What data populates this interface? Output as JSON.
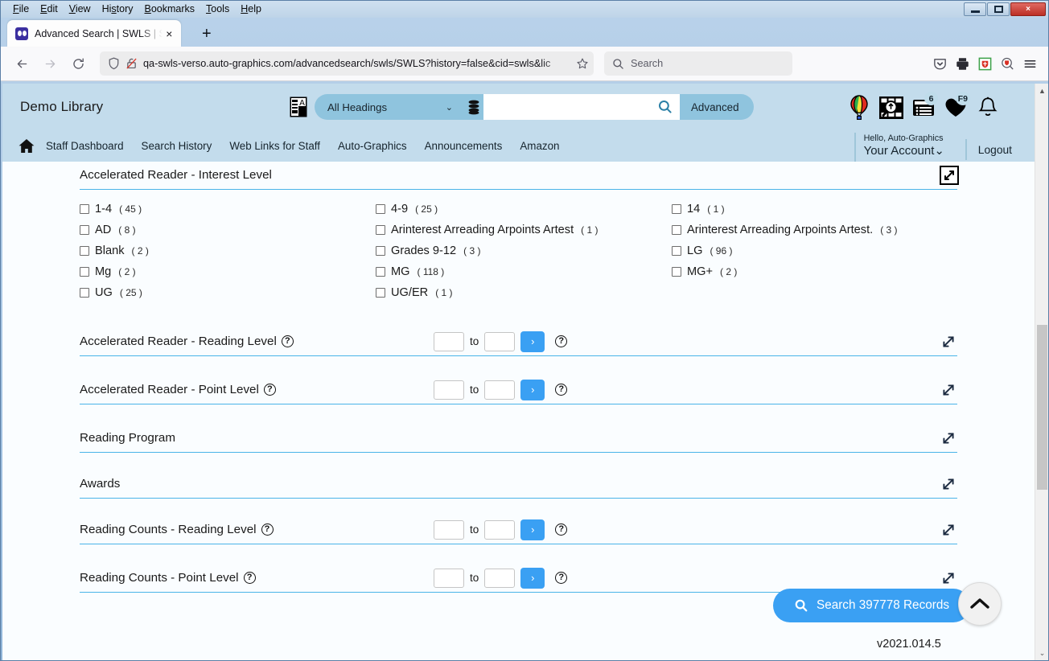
{
  "browser": {
    "menus": [
      "File",
      "Edit",
      "View",
      "History",
      "Bookmarks",
      "Tools",
      "Help"
    ],
    "window_controls": {
      "minimize": "minimize-icon",
      "maximize": "maximize-icon",
      "close": "×"
    },
    "tab": {
      "title": "Advanced Search | SWLS | SWLS",
      "close": "×",
      "favicon": "book-favicon"
    },
    "new_tab": "+",
    "nav": {
      "back": "back-arrow-icon",
      "forward": "forward-arrow-icon",
      "reload": "reload-icon",
      "shield": "shield-icon",
      "lock_broken": "broken-lock-icon",
      "url": "qa-swls-verso.auto-graphics.com/advancedsearch/swls/SWLS?history=false&cid=swls&lic",
      "bookmark_star": "star-icon"
    },
    "search": {
      "placeholder": "Search",
      "icon": "search-icon"
    },
    "toolbar_icons": [
      "pocket-icon",
      "print-icon",
      "extension-icon",
      "extension-search-icon",
      "hamburger-menu-icon"
    ]
  },
  "site": {
    "library_name": "Demo Library",
    "keyboard_icon": "virtual-keyboard-icon",
    "scope": {
      "selected": "All Headings",
      "chevron": "⌄",
      "database_icon": "database-icon"
    },
    "search_input_value": "",
    "search_button_icon": "search-icon",
    "advanced_label": "Advanced",
    "header_icons": [
      {
        "name": "balloon-icon",
        "badge": ""
      },
      {
        "name": "image-search-icon",
        "badge": ""
      },
      {
        "name": "my-lists-icon",
        "badge": "6"
      },
      {
        "name": "favorites-heart-icon",
        "badge": "F9"
      },
      {
        "name": "notifications-bell-icon",
        "badge": ""
      }
    ],
    "nav": {
      "home_icon": "home-icon",
      "links": [
        "Staff Dashboard",
        "Search History",
        "Web Links for Staff",
        "Auto-Graphics",
        "Announcements",
        "Amazon"
      ]
    },
    "account": {
      "greeting": "Hello, Auto-Graphics",
      "label": "Your Account",
      "chevron": "⌄"
    },
    "logout": "Logout"
  },
  "facets": [
    {
      "title": "Accelerated Reader - Interest Level",
      "expanded": true,
      "has_help": false,
      "has_range": false,
      "toggle_icon": "collapse-icon",
      "options": [
        {
          "label": "1-4",
          "count": "( 45 )"
        },
        {
          "label": "4-9",
          "count": "( 25 )"
        },
        {
          "label": "14",
          "count": "( 1 )"
        },
        {
          "label": "AD",
          "count": "( 8 )"
        },
        {
          "label": "Arinterest Arreading Arpoints Artest",
          "count": "( 1 )"
        },
        {
          "label": "Arinterest Arreading Arpoints Artest.",
          "count": "( 3 )"
        },
        {
          "label": "Blank",
          "count": "( 2 )"
        },
        {
          "label": "Grades 9-12",
          "count": "( 3 )"
        },
        {
          "label": "LG",
          "count": "( 96 )"
        },
        {
          "label": "Mg",
          "count": "( 2 )"
        },
        {
          "label": "MG",
          "count": "( 118 )"
        },
        {
          "label": "MG+",
          "count": "( 2 )"
        },
        {
          "label": "UG",
          "count": "( 25 )"
        },
        {
          "label": "UG/ER",
          "count": "( 1 )"
        },
        {
          "label": "",
          "count": ""
        }
      ]
    },
    {
      "title": "Accelerated Reader - Reading Level",
      "expanded": false,
      "has_help": true,
      "has_range": true,
      "toggle_icon": "expand-icon",
      "range": {
        "from": "",
        "to_label": "to",
        "to": "",
        "go": "›",
        "help": "?"
      }
    },
    {
      "title": "Accelerated Reader - Point Level",
      "expanded": false,
      "has_help": true,
      "has_range": true,
      "toggle_icon": "expand-icon",
      "range": {
        "from": "",
        "to_label": "to",
        "to": "",
        "go": "›",
        "help": "?"
      }
    },
    {
      "title": "Reading Program",
      "expanded": false,
      "has_help": false,
      "has_range": false,
      "toggle_icon": "expand-icon"
    },
    {
      "title": "Awards",
      "expanded": false,
      "has_help": false,
      "has_range": false,
      "toggle_icon": "expand-icon"
    },
    {
      "title": "Reading Counts - Reading Level",
      "expanded": false,
      "has_help": true,
      "has_range": true,
      "toggle_icon": "expand-icon",
      "range": {
        "from": "",
        "to_label": "to",
        "to": "",
        "go": "›",
        "help": "?"
      }
    },
    {
      "title": "Reading Counts - Point Level",
      "expanded": false,
      "has_help": true,
      "has_range": true,
      "toggle_icon": "expand-icon",
      "range": {
        "from": "",
        "to_label": "to",
        "to": "",
        "go": "›",
        "help": "?"
      }
    }
  ],
  "footer": {
    "search_button": "Search 397778 Records",
    "search_icon": "search-icon",
    "scroll_top_icon": "chevron-up-icon",
    "version": "v2021.014.5"
  },
  "colors": {
    "header_bg": "#c3dcec",
    "accent_blue": "#3aa0f3",
    "rule_blue": "#4ab4e8",
    "pill_blue": "#8fc4de",
    "content_bg": "#fafdff"
  }
}
